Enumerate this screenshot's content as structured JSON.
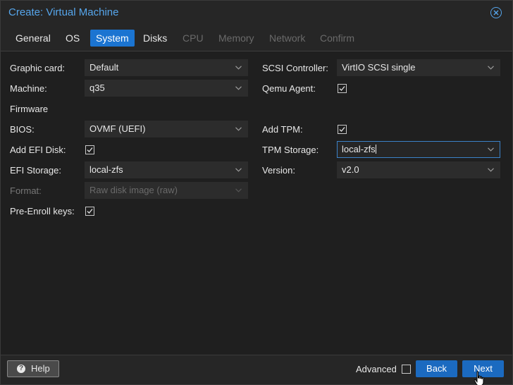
{
  "window": {
    "title": "Create: Virtual Machine"
  },
  "tabs": [
    {
      "label": "General",
      "state": "normal"
    },
    {
      "label": "OS",
      "state": "normal"
    },
    {
      "label": "System",
      "state": "active"
    },
    {
      "label": "Disks",
      "state": "normal"
    },
    {
      "label": "CPU",
      "state": "disabled"
    },
    {
      "label": "Memory",
      "state": "disabled"
    },
    {
      "label": "Network",
      "state": "disabled"
    },
    {
      "label": "Confirm",
      "state": "disabled"
    }
  ],
  "form": {
    "graphic_card": {
      "label": "Graphic card:",
      "value": "Default"
    },
    "machine": {
      "label": "Machine:",
      "value": "q35"
    },
    "firmware_heading": "Firmware",
    "bios": {
      "label": "BIOS:",
      "value": "OVMF (UEFI)"
    },
    "add_efi_disk": {
      "label": "Add EFI Disk:",
      "checked": true
    },
    "efi_storage": {
      "label": "EFI Storage:",
      "value": "local-zfs"
    },
    "format": {
      "label": "Format:",
      "value": "Raw disk image (raw)",
      "disabled": true
    },
    "pre_enroll_keys": {
      "label": "Pre-Enroll keys:",
      "checked": true
    },
    "scsi_controller": {
      "label": "SCSI Controller:",
      "value": "VirtIO SCSI single"
    },
    "qemu_agent": {
      "label": "Qemu Agent:",
      "checked": true
    },
    "add_tpm": {
      "label": "Add TPM:",
      "checked": true
    },
    "tpm_storage": {
      "label": "TPM Storage:",
      "value": "local-zfs"
    },
    "version": {
      "label": "Version:",
      "value": "v2.0"
    }
  },
  "footer": {
    "help_label": "Help",
    "advanced_label": "Advanced",
    "advanced_checked": false,
    "back_label": "Back",
    "next_label": "Next"
  },
  "colors": {
    "accent": "#1b74d1",
    "title": "#56a6ec",
    "button": "#1b6ac0"
  }
}
